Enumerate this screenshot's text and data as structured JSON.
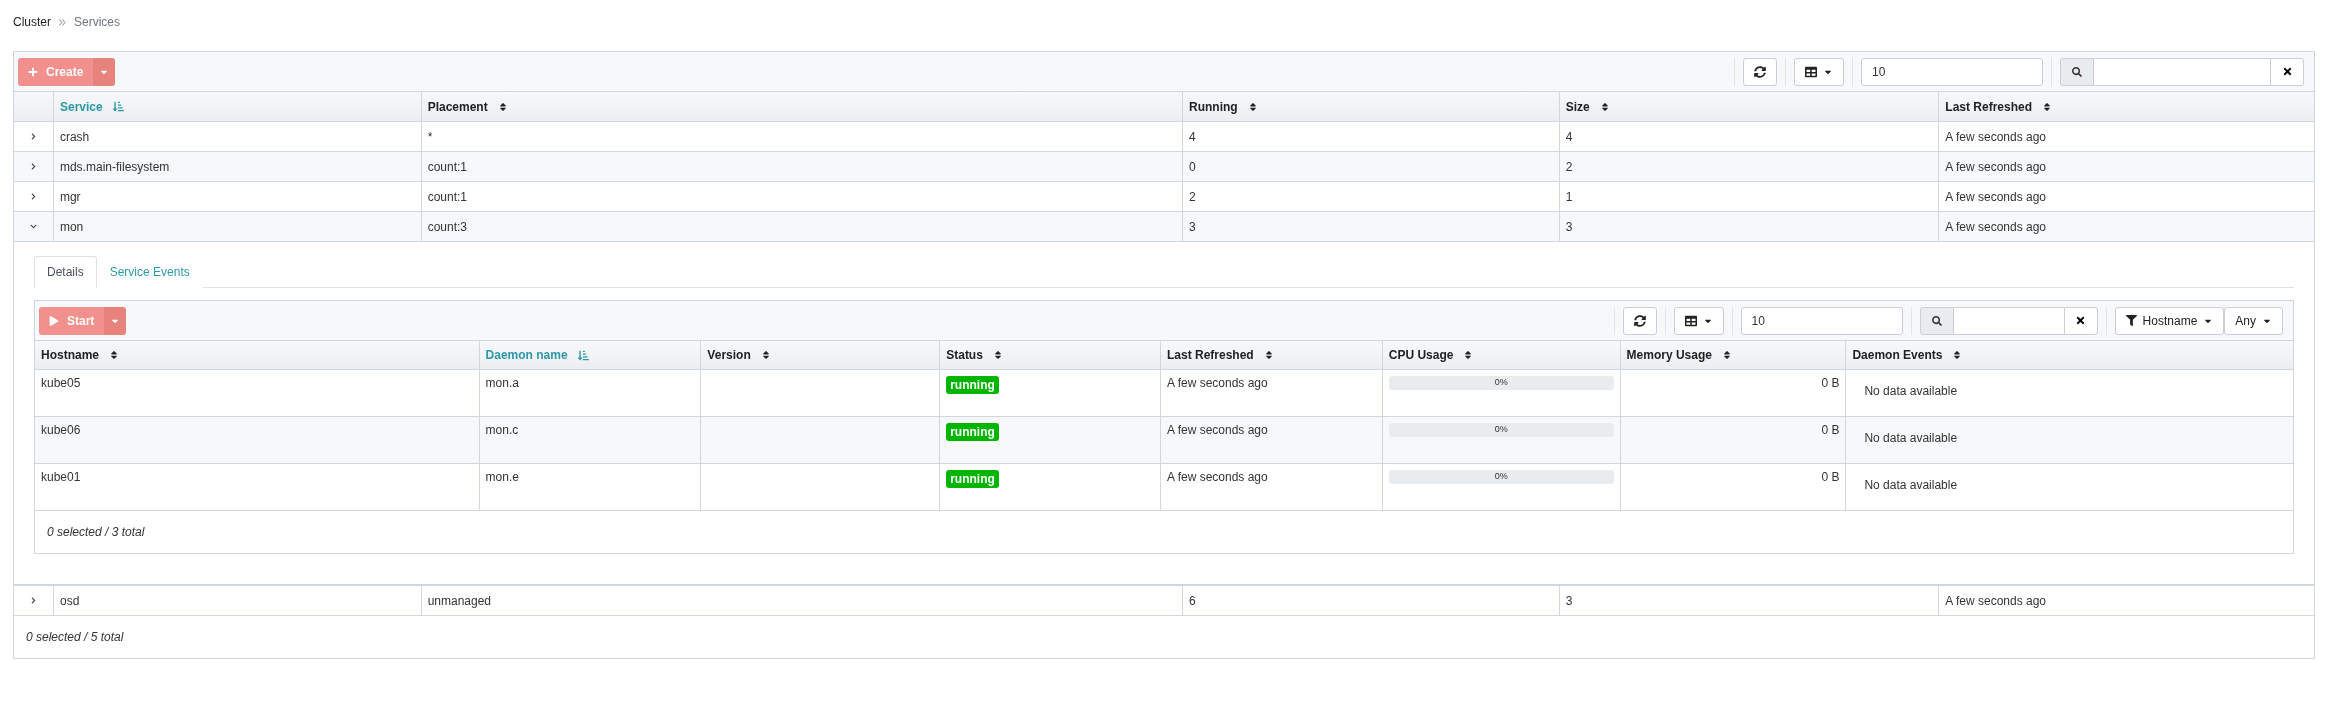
{
  "breadcrumb": [
    "Cluster",
    "Services"
  ],
  "services": {
    "create_button": {
      "label": "Create",
      "disabled": true
    },
    "page_size": "10",
    "columns": [
      {
        "label": "Service",
        "sorted": true
      },
      {
        "label": "Placement",
        "sorted": false
      },
      {
        "label": "Running",
        "sorted": false
      },
      {
        "label": "Size",
        "sorted": false
      },
      {
        "label": "Last Refreshed",
        "sorted": false
      }
    ],
    "rows": [
      {
        "expanded": false,
        "cells": [
          "crash",
          "*",
          "4",
          "4",
          "A few seconds ago"
        ]
      },
      {
        "expanded": false,
        "cells": [
          "mds.main-filesystem",
          "count:1",
          "0",
          "2",
          "A few seconds ago"
        ]
      },
      {
        "expanded": false,
        "cells": [
          "mgr",
          "count:1",
          "2",
          "1",
          "A few seconds ago"
        ]
      },
      {
        "expanded": true,
        "cells": [
          "mon",
          "count:3",
          "3",
          "3",
          "A few seconds ago"
        ],
        "details": {
          "tabs": [
            {
              "label": "Details",
              "selected": true
            },
            {
              "label": "Service Events",
              "selected": false
            }
          ],
          "start_button": {
            "label": "Start",
            "disabled": true
          },
          "page_size": "10",
          "filter": {
            "column": "Hostname",
            "value": "Any"
          },
          "columns": [
            {
              "label": "Hostname",
              "sorted": false
            },
            {
              "label": "Daemon name",
              "sorted": true
            },
            {
              "label": "Version",
              "sorted": false
            },
            {
              "label": "Status",
              "sorted": false
            },
            {
              "label": "Last Refreshed",
              "sorted": false
            },
            {
              "label": "CPU Usage",
              "sorted": false
            },
            {
              "label": "Memory Usage",
              "sorted": false
            },
            {
              "label": "Daemon Events",
              "sorted": false
            }
          ],
          "rows": [
            {
              "hostname": "kube05",
              "daemon_name": "mon.a",
              "status": "running",
              "last_refreshed": "A few seconds ago",
              "cpu": {
                "level": 0,
                "reading": "0%"
              },
              "memory": "0 B",
              "events": "No data available"
            },
            {
              "hostname": "kube06",
              "daemon_name": "mon.c",
              "status": "running",
              "last_refreshed": "A few seconds ago",
              "cpu": {
                "level": 0,
                "reading": "0%"
              },
              "memory": "0 B",
              "events": "No data available"
            },
            {
              "hostname": "kube01",
              "daemon_name": "mon.e",
              "status": "running",
              "last_refreshed": "A few seconds ago",
              "cpu": {
                "level": 0,
                "reading": "0%"
              },
              "memory": "0 B",
              "events": "No data available"
            }
          ],
          "footer": "0 selected / 3 total"
        }
      },
      {
        "expanded": false,
        "cells": [
          "osd",
          "unmanaged",
          "6",
          "3",
          "A few seconds ago"
        ]
      }
    ],
    "footer": "0 selected / 5 total"
  }
}
